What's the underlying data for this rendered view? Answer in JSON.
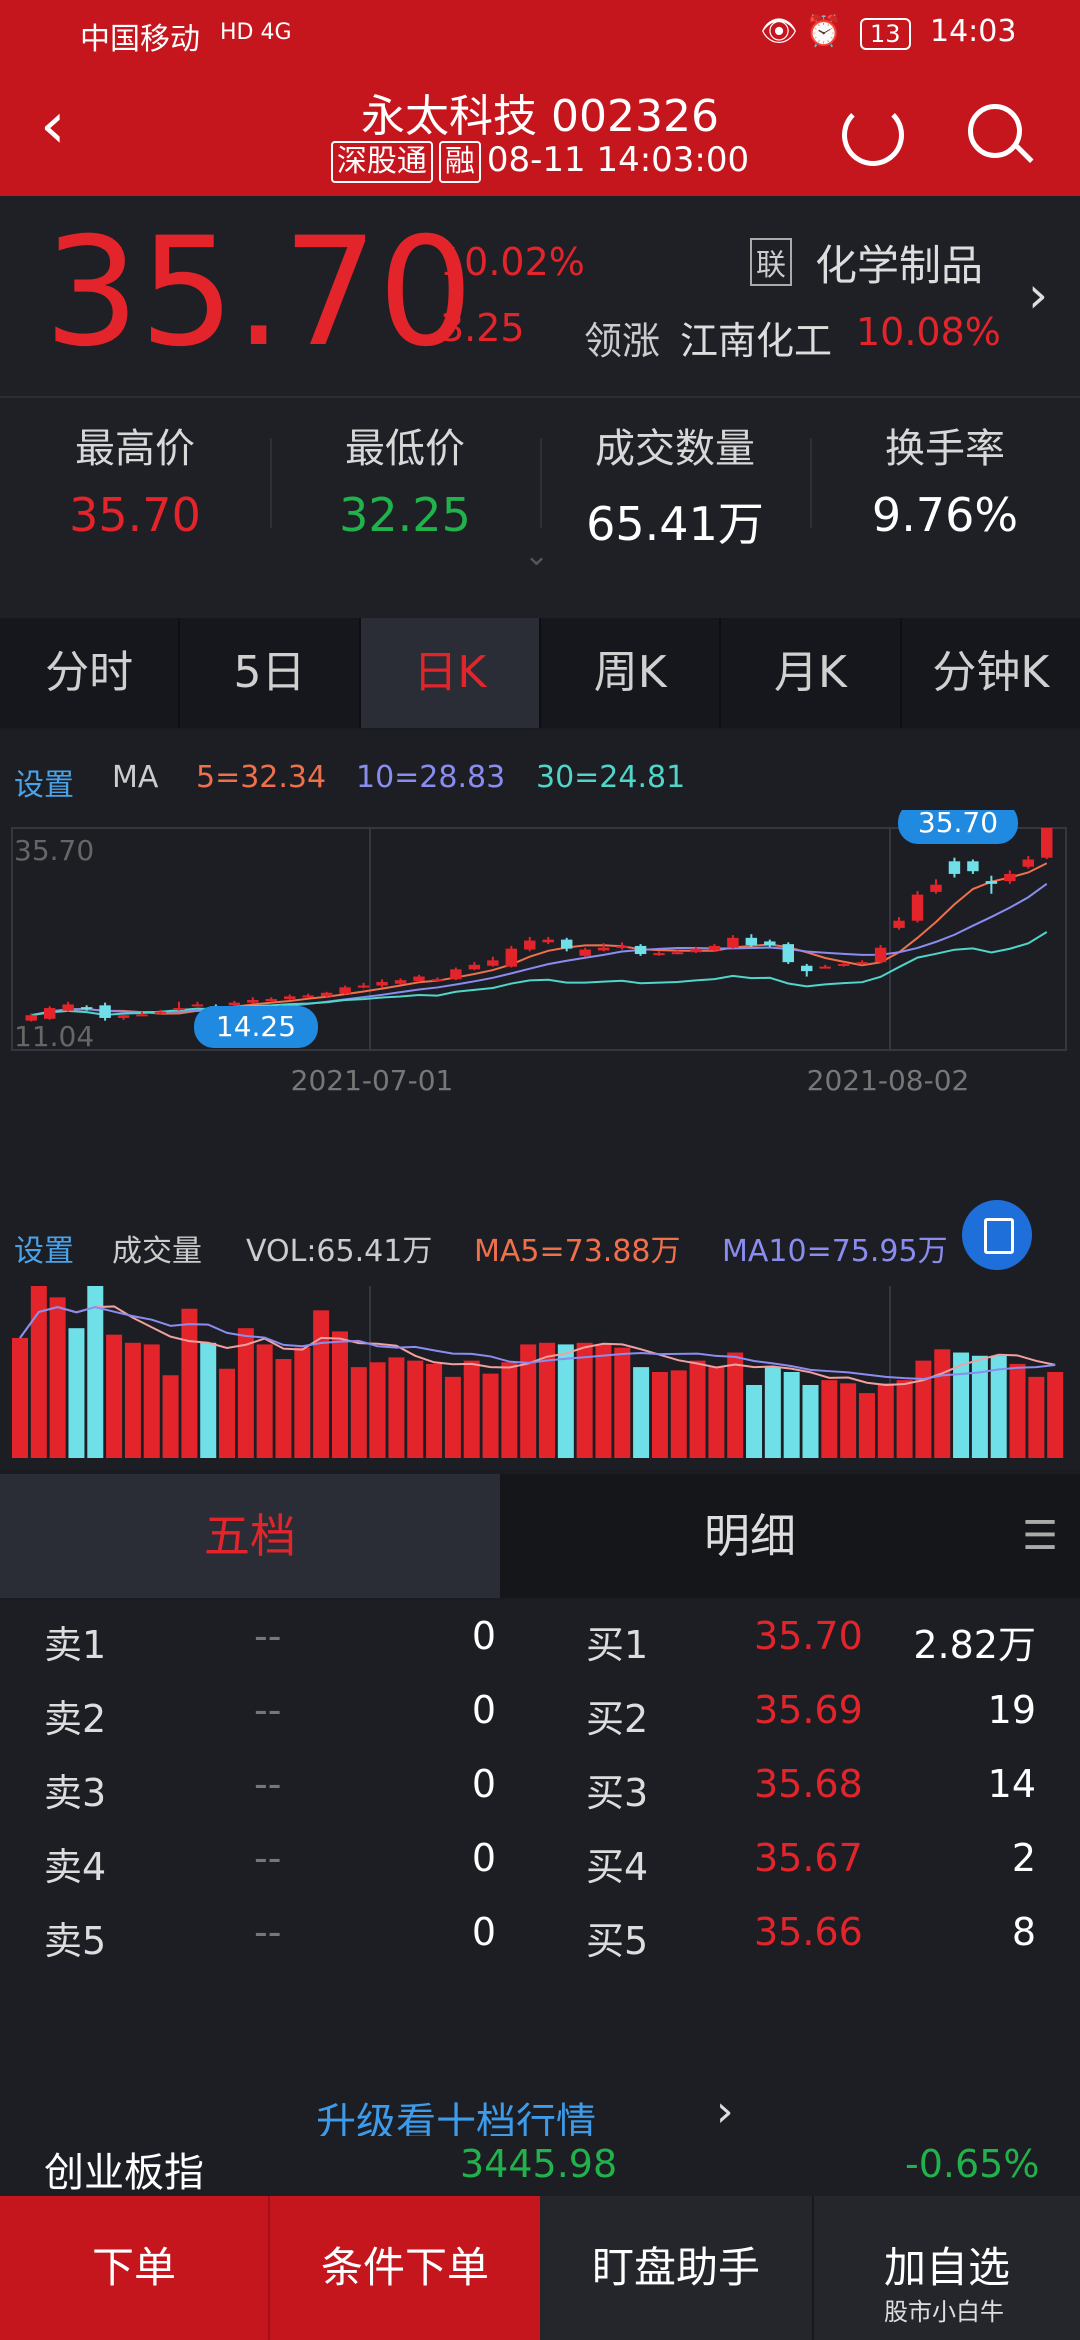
{
  "status_bar": {
    "carrier": "中国移动",
    "net": "HD 4G",
    "battery": "13",
    "time": "14:03"
  },
  "header": {
    "title": "永太科技 002326",
    "tag1": "深股通",
    "tag2": "融",
    "datetime": "08-11 14:03:00"
  },
  "quote": {
    "price": "35.70",
    "pct": "10.02%",
    "change": "3.25",
    "sector_tag": "联",
    "sector": "化学制品",
    "lead_label": "领涨",
    "lead_stock": "江南化工",
    "lead_pct": "10.08%"
  },
  "stats": [
    {
      "label": "最高价",
      "value": "35.70",
      "color": "#e3242b"
    },
    {
      "label": "最低价",
      "value": "32.25",
      "color": "#22b24c"
    },
    {
      "label": "成交数量",
      "value": "65.41万",
      "color": "#ffffff"
    },
    {
      "label": "换手率",
      "value": "9.76%",
      "color": "#ffffff"
    }
  ],
  "tabs": [
    "分时",
    "5日",
    "日K",
    "周K",
    "月K",
    "分钟K"
  ],
  "active_tab": "日K",
  "ma_legend": {
    "settings": "设置",
    "ma": "MA",
    "ma5": "5=32.34",
    "ma10": "10=28.83",
    "ma30": "30=24.81"
  },
  "chart_data": {
    "type": "candlestick",
    "y_max_label": "35.70",
    "y_min_label": "11.04",
    "ylim": [
      11.04,
      35.7
    ],
    "high_marker": "35.70",
    "low_marker": "14.25",
    "x_ticks": [
      "2021-07-01",
      "2021-08-02"
    ],
    "candles": [
      {
        "o": 14.3,
        "c": 14.9,
        "h": 15.1,
        "l": 14.2
      },
      {
        "o": 14.5,
        "c": 15.7,
        "h": 15.9,
        "l": 14.4
      },
      {
        "o": 15.4,
        "c": 16.1,
        "h": 16.4,
        "l": 15.3
      },
      {
        "o": 15.8,
        "c": 15.6,
        "h": 16.0,
        "l": 15.4
      },
      {
        "o": 16.0,
        "c": 14.6,
        "h": 16.3,
        "l": 14.3
      },
      {
        "o": 14.6,
        "c": 14.9,
        "h": 15.0,
        "l": 14.4
      },
      {
        "o": 14.9,
        "c": 15.0,
        "h": 15.3,
        "l": 14.8
      },
      {
        "o": 15.1,
        "c": 15.3,
        "h": 15.5,
        "l": 15.0
      },
      {
        "o": 15.5,
        "c": 15.7,
        "h": 16.4,
        "l": 15.4
      },
      {
        "o": 16.0,
        "c": 16.1,
        "h": 16.4,
        "l": 15.9
      },
      {
        "o": 15.9,
        "c": 15.8,
        "h": 16.1,
        "l": 15.6
      },
      {
        "o": 16.0,
        "c": 16.3,
        "h": 16.5,
        "l": 15.9
      },
      {
        "o": 16.3,
        "c": 16.6,
        "h": 16.9,
        "l": 16.2
      },
      {
        "o": 16.6,
        "c": 16.7,
        "h": 16.9,
        "l": 16.5
      },
      {
        "o": 16.7,
        "c": 17.0,
        "h": 17.2,
        "l": 16.6
      },
      {
        "o": 17.0,
        "c": 17.1,
        "h": 17.3,
        "l": 16.9
      },
      {
        "o": 17.0,
        "c": 17.4,
        "h": 17.5,
        "l": 16.9
      },
      {
        "o": 17.3,
        "c": 18.0,
        "h": 18.2,
        "l": 17.2
      },
      {
        "o": 18.0,
        "c": 18.2,
        "h": 18.5,
        "l": 17.9
      },
      {
        "o": 18.2,
        "c": 18.6,
        "h": 18.9,
        "l": 18.0
      },
      {
        "o": 18.4,
        "c": 18.8,
        "h": 19.0,
        "l": 18.3
      },
      {
        "o": 18.7,
        "c": 19.2,
        "h": 19.4,
        "l": 18.6
      },
      {
        "o": 18.8,
        "c": 18.9,
        "h": 19.1,
        "l": 18.6
      },
      {
        "o": 18.9,
        "c": 20.0,
        "h": 20.2,
        "l": 18.8
      },
      {
        "o": 20.0,
        "c": 20.5,
        "h": 20.8,
        "l": 19.9
      },
      {
        "o": 20.4,
        "c": 21.0,
        "h": 21.4,
        "l": 20.3
      },
      {
        "o": 20.3,
        "c": 22.3,
        "h": 22.6,
        "l": 20.2
      },
      {
        "o": 22.2,
        "c": 23.2,
        "h": 23.6,
        "l": 22.0
      },
      {
        "o": 23.0,
        "c": 23.3,
        "h": 23.6,
        "l": 22.8
      },
      {
        "o": 23.3,
        "c": 22.3,
        "h": 23.5,
        "l": 22.0
      },
      {
        "o": 21.5,
        "c": 22.2,
        "h": 22.4,
        "l": 21.4
      },
      {
        "o": 22.1,
        "c": 22.4,
        "h": 22.9,
        "l": 22.0
      },
      {
        "o": 22.4,
        "c": 22.6,
        "h": 23.0,
        "l": 22.2
      },
      {
        "o": 22.6,
        "c": 21.7,
        "h": 22.8,
        "l": 21.5
      },
      {
        "o": 21.7,
        "c": 21.8,
        "h": 22.0,
        "l": 21.5
      },
      {
        "o": 21.8,
        "c": 21.9,
        "h": 22.1,
        "l": 21.7
      },
      {
        "o": 21.9,
        "c": 22.3,
        "h": 22.5,
        "l": 21.8
      },
      {
        "o": 22.1,
        "c": 22.6,
        "h": 22.8,
        "l": 22.0
      },
      {
        "o": 22.4,
        "c": 23.5,
        "h": 23.8,
        "l": 22.3
      },
      {
        "o": 23.5,
        "c": 22.7,
        "h": 23.9,
        "l": 22.5
      },
      {
        "o": 23.1,
        "c": 22.7,
        "h": 23.3,
        "l": 22.5
      },
      {
        "o": 22.8,
        "c": 20.8,
        "h": 23.0,
        "l": 20.6
      },
      {
        "o": 20.4,
        "c": 19.8,
        "h": 20.6,
        "l": 19.2
      },
      {
        "o": 20.2,
        "c": 20.3,
        "h": 20.5,
        "l": 20.1
      },
      {
        "o": 20.4,
        "c": 20.6,
        "h": 20.8,
        "l": 20.3
      },
      {
        "o": 20.6,
        "c": 20.8,
        "h": 21.0,
        "l": 20.5
      },
      {
        "o": 20.8,
        "c": 22.4,
        "h": 22.7,
        "l": 20.7
      },
      {
        "o": 24.6,
        "c": 25.4,
        "h": 25.8,
        "l": 24.4
      },
      {
        "o": 25.4,
        "c": 28.3,
        "h": 28.7,
        "l": 25.2
      },
      {
        "o": 28.6,
        "c": 29.4,
        "h": 30.0,
        "l": 28.4
      },
      {
        "o": 32.0,
        "c": 30.6,
        "h": 32.4,
        "l": 30.2
      },
      {
        "o": 32.0,
        "c": 30.9,
        "h": 32.2,
        "l": 30.6
      },
      {
        "o": 29.8,
        "c": 29.5,
        "h": 30.4,
        "l": 28.4
      },
      {
        "o": 29.8,
        "c": 30.6,
        "h": 31.0,
        "l": 29.5
      },
      {
        "o": 31.4,
        "c": 32.2,
        "h": 32.6,
        "l": 31.2
      },
      {
        "o": 32.4,
        "c": 35.7,
        "h": 35.7,
        "l": 32.25
      }
    ]
  },
  "vol_legend": {
    "settings": "设置",
    "label": "成交量",
    "vol": "VOL:65.41万",
    "ma5": "MA5=73.88万",
    "ma10": "MA10=75.95万"
  },
  "volume_data": [
    74,
    106,
    99,
    80,
    106,
    76,
    71,
    70,
    51,
    92,
    71,
    55,
    80,
    70,
    61,
    68,
    91,
    78,
    56,
    59,
    62,
    60,
    58,
    50,
    60,
    52,
    59,
    70,
    71,
    70,
    71,
    70,
    68,
    56,
    53,
    54,
    60,
    56,
    65,
    45,
    56,
    53,
    45,
    48,
    46,
    40,
    46,
    48,
    60,
    67,
    65,
    63,
    63,
    58,
    50,
    53
  ],
  "five_tabs": {
    "five": "五档",
    "detail": "明细"
  },
  "sell": [
    {
      "label": "卖1",
      "price": "--",
      "vol": "0"
    },
    {
      "label": "卖2",
      "price": "--",
      "vol": "0"
    },
    {
      "label": "卖3",
      "price": "--",
      "vol": "0"
    },
    {
      "label": "卖4",
      "price": "--",
      "vol": "0"
    },
    {
      "label": "卖5",
      "price": "--",
      "vol": "0"
    }
  ],
  "buy": [
    {
      "label": "买1",
      "price": "35.70",
      "vol": "2.82万"
    },
    {
      "label": "买2",
      "price": "35.69",
      "vol": "19"
    },
    {
      "label": "买3",
      "price": "35.68",
      "vol": "14"
    },
    {
      "label": "买4",
      "price": "35.67",
      "vol": "2"
    },
    {
      "label": "买5",
      "price": "35.66",
      "vol": "8"
    }
  ],
  "upgrade": "升级看十档行情",
  "index": {
    "name": "创业板指",
    "value": "3445.98",
    "pct": "-0.65%"
  },
  "bottom": [
    "下单",
    "条件下单",
    "盯盘助手",
    "加自选"
  ],
  "watermark": "股市小白牛"
}
